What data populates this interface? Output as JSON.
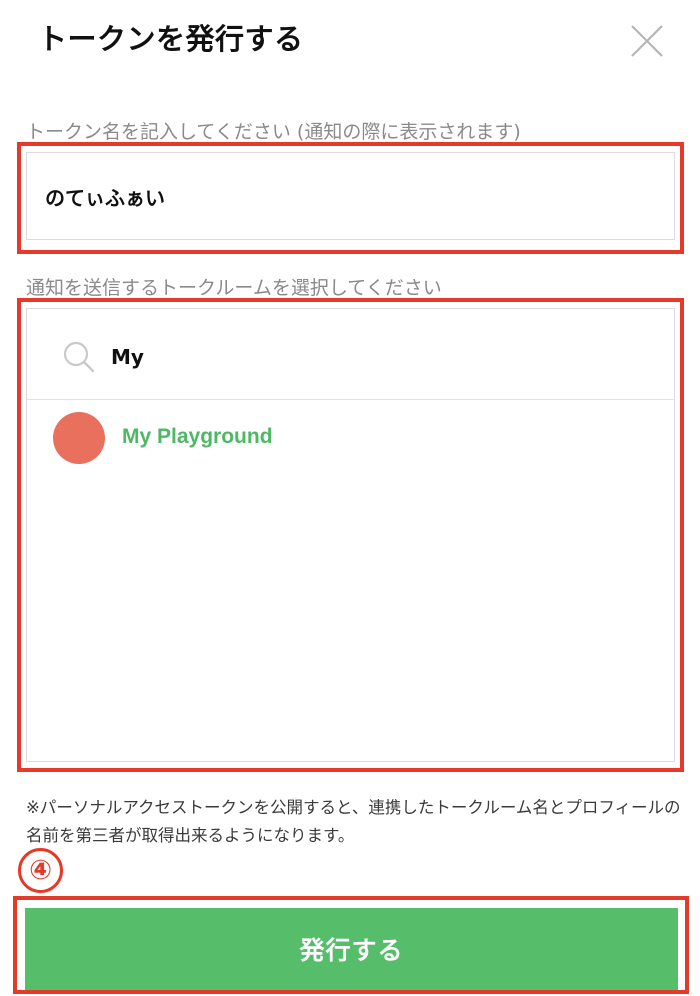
{
  "dialog": {
    "title": "トークンを発行する",
    "close_icon": "close-icon"
  },
  "token_name": {
    "label": "トークン名を記入してください (通知の際に表示されます)",
    "value": "のてぃふぁい"
  },
  "talk_room": {
    "label": "通知を送信するトークルームを選択してください",
    "search_icon": "search-icon",
    "search_value": "My",
    "results": [
      {
        "name": "My Playground",
        "avatar_color": "#e8705c"
      }
    ]
  },
  "notice": "※パーソナルアクセストークンを公開すると、連携したトークルーム名とプロフィールの名前を第三者が取得出来るようになります。",
  "step_marker": "④",
  "submit_label": "発行する",
  "colors": {
    "accent_green": "#56bd6a",
    "highlight_red": "#e53a2a",
    "room_name_green": "#4db964"
  }
}
